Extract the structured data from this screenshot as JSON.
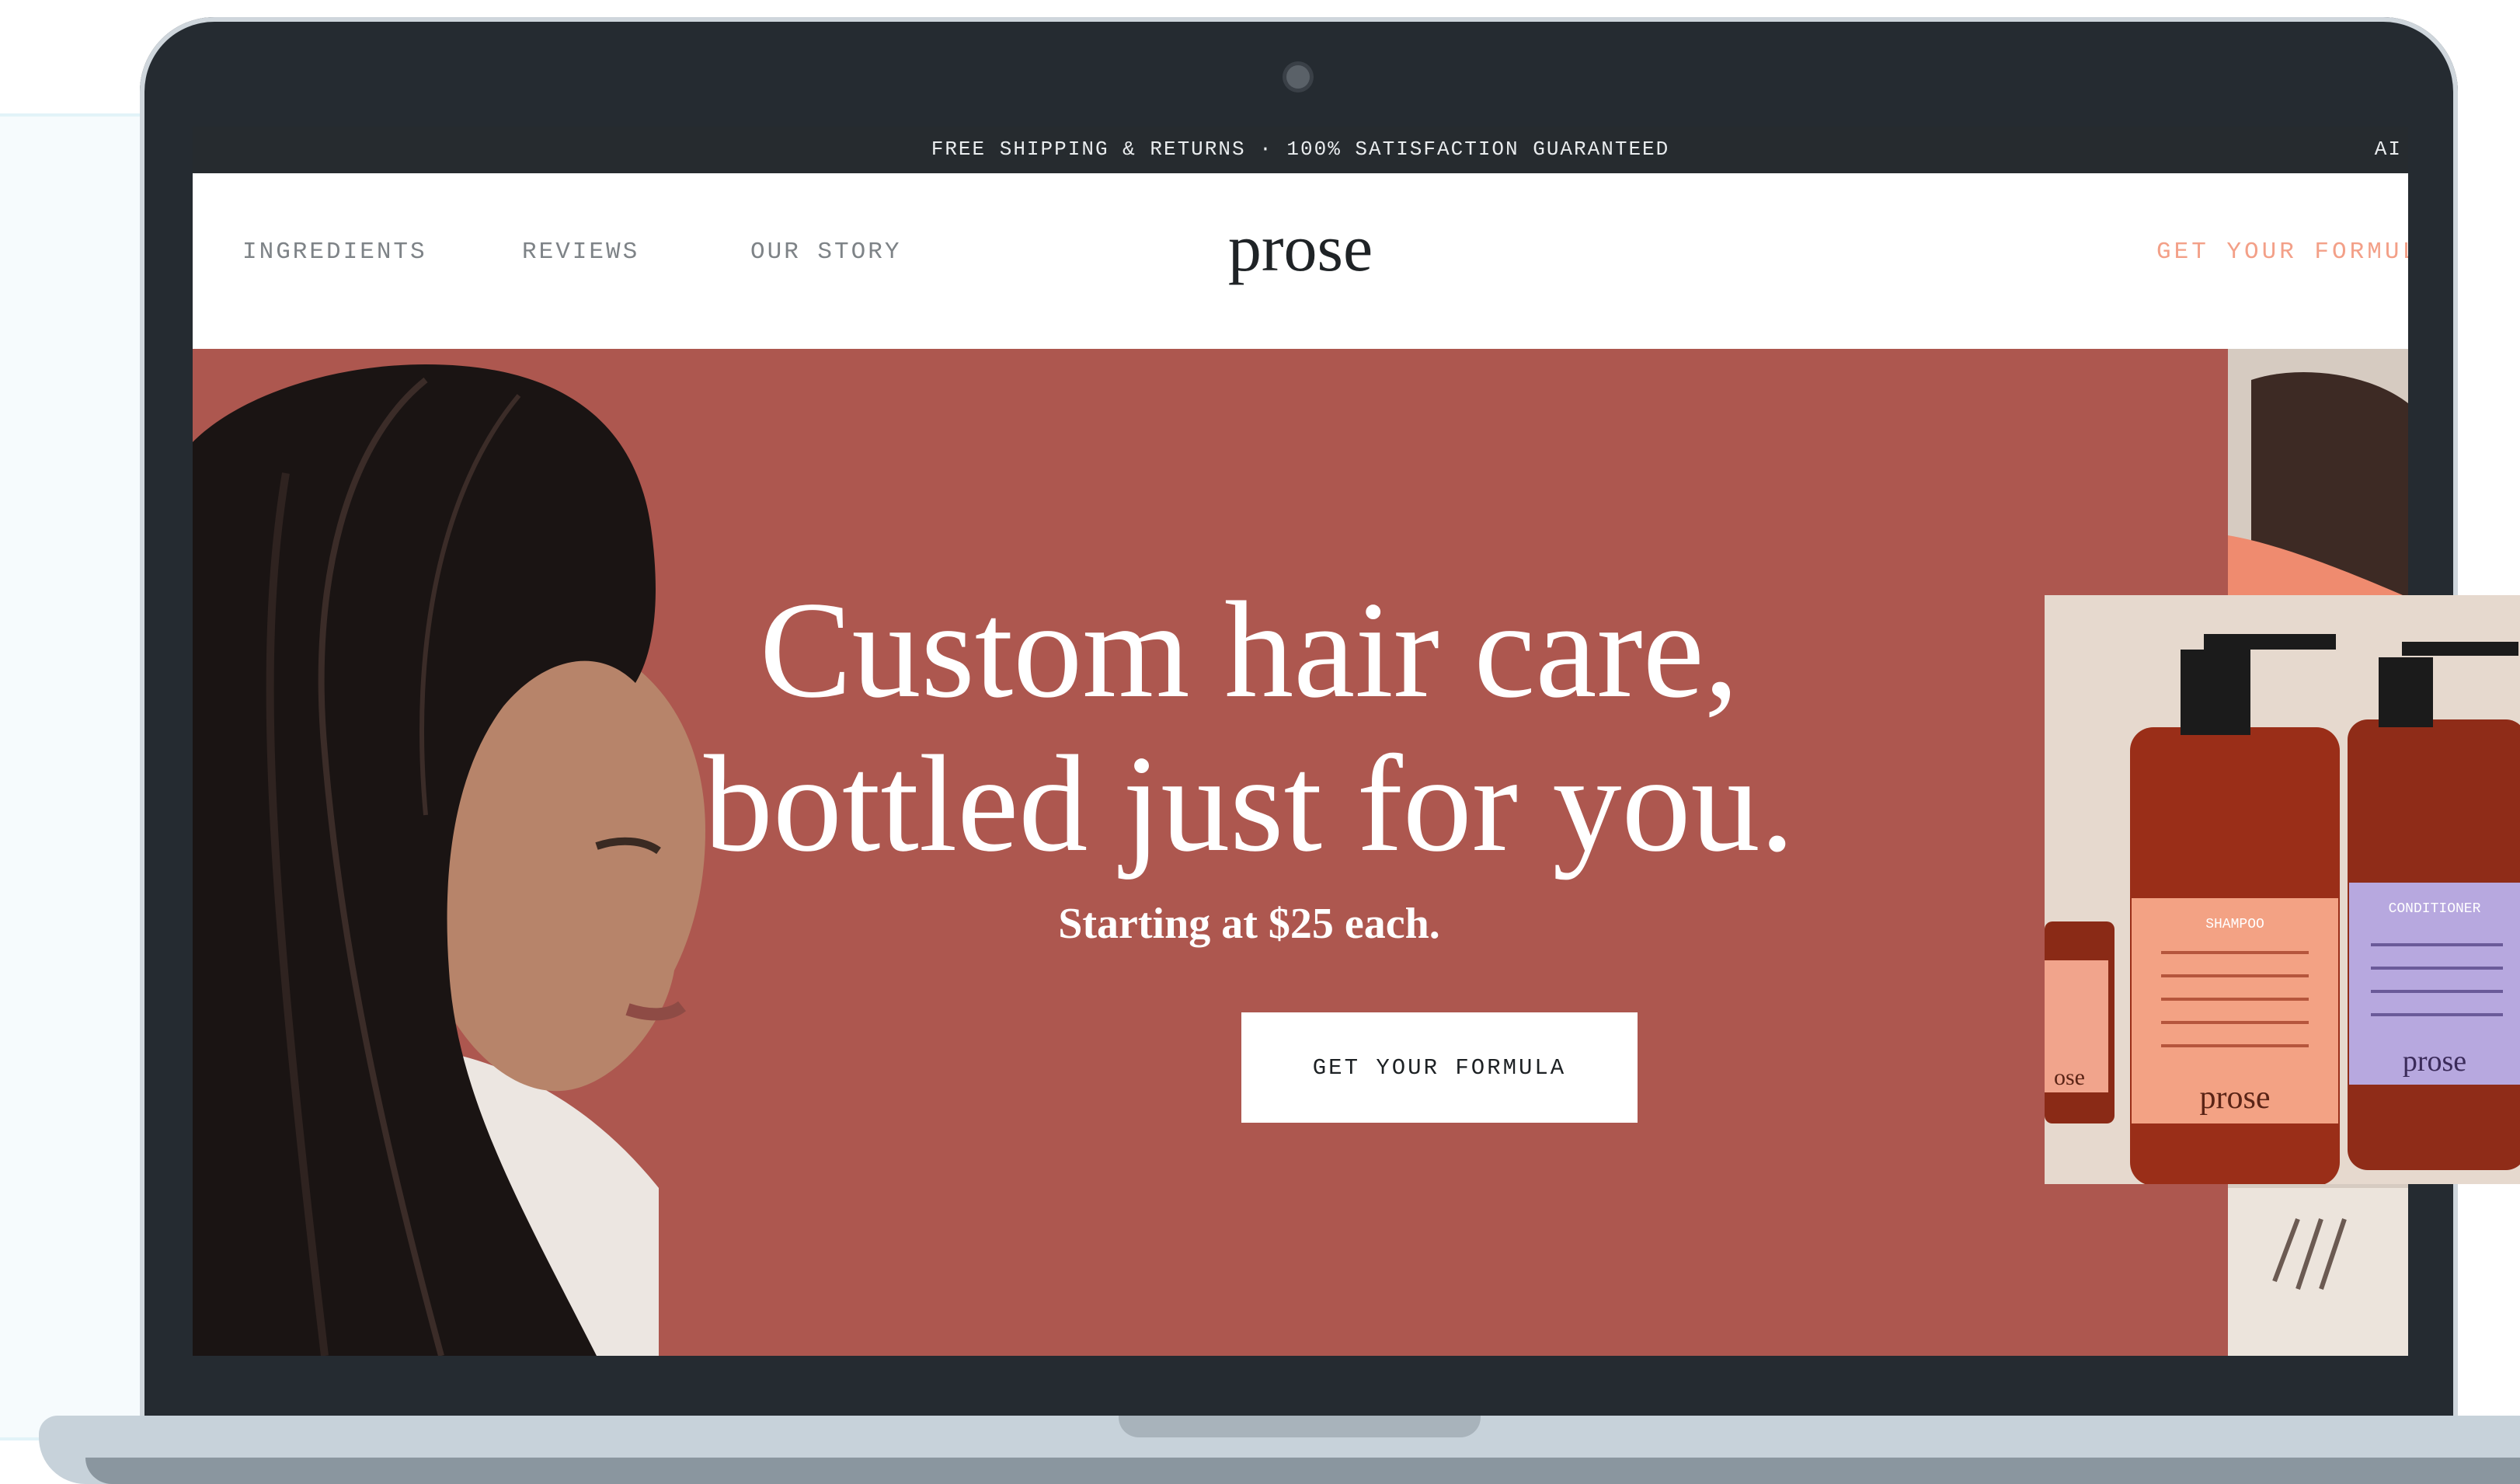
{
  "announcement": {
    "text": "FREE SHIPPING & RETURNS · 100% SATISFACTION GUARANTEED",
    "right_fragment": "AI"
  },
  "nav": {
    "links": [
      "INGREDIENTS",
      "REVIEWS",
      "OUR STORY"
    ],
    "logo": "prose",
    "cta": "GET YOUR FORMULA"
  },
  "hero": {
    "headline_line1": "Custom hair care,",
    "headline_line2": "bottled just for you.",
    "subline": "Starting at $25 each.",
    "button": "GET YOUR FORMULA"
  },
  "product_card": {
    "bottle_brand": "prose",
    "shampoo_label": "SHAMPOO",
    "conditioner_label": "CONDITIONER"
  },
  "colors": {
    "hero_bg": "#ad574f",
    "announce_bg": "#262b2f",
    "cta_text": "#f3a088",
    "laptop_frame": "#252b31"
  }
}
